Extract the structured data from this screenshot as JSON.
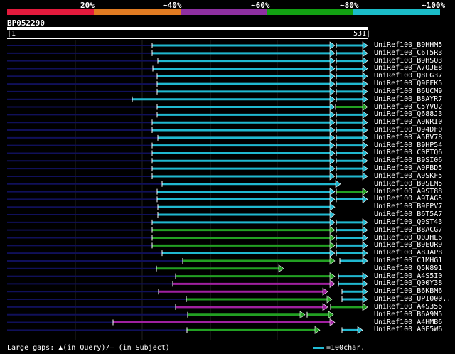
{
  "legend": {
    "colors": [
      "#e31a3c",
      "#e07b22",
      "#8e2fa0",
      "#12a012",
      "#1bbcc8"
    ],
    "ticks": [
      "20%",
      "~40%",
      "~60%",
      "~80%",
      "~100%"
    ]
  },
  "query": {
    "id": "BP052290",
    "start": "1",
    "end": "531"
  },
  "colors": {
    "cyan": "#20b8d0",
    "green": "#22a022",
    "magenta": "#a020a0",
    "navy": "#10105a",
    "white": "#ffffff"
  },
  "hits": [
    {
      "label": "UniRef100_B9HHM5",
      "segs": [
        [
          "n",
          10,
          214
        ],
        [
          "c",
          214,
          470
        ],
        [
          "c",
          473,
          516
        ]
      ]
    },
    {
      "label": "UniRef100_C6T5R3",
      "segs": [
        [
          "n",
          10,
          214
        ],
        [
          "c",
          214,
          470
        ],
        [
          "c",
          473,
          516
        ]
      ]
    },
    {
      "label": "UniRef100_B9HSQ3",
      "segs": [
        [
          "n",
          10,
          222
        ],
        [
          "c",
          222,
          470
        ],
        [
          "c",
          473,
          516
        ]
      ]
    },
    {
      "label": "UniRef100_A7QJE8",
      "segs": [
        [
          "n",
          10,
          215
        ],
        [
          "c",
          215,
          470
        ],
        [
          "c",
          473,
          516
        ]
      ]
    },
    {
      "label": "UniRef100_Q8LG37",
      "segs": [
        [
          "n",
          10,
          221
        ],
        [
          "c",
          221,
          470
        ],
        [
          "c",
          473,
          516
        ]
      ]
    },
    {
      "label": "UniRef100_Q9FFK5",
      "segs": [
        [
          "n",
          10,
          221
        ],
        [
          "c",
          221,
          470
        ],
        [
          "c",
          473,
          516
        ]
      ]
    },
    {
      "label": "UniRef100_B6UCM9",
      "segs": [
        [
          "n",
          10,
          221
        ],
        [
          "c",
          221,
          470
        ],
        [
          "c",
          473,
          516
        ]
      ]
    },
    {
      "label": "UniRef100_B8AYR7",
      "segs": [
        [
          "n",
          10,
          186
        ],
        [
          "c",
          186,
          470
        ],
        [
          "c",
          473,
          516
        ]
      ]
    },
    {
      "label": "UniRef100_C5YVU2",
      "segs": [
        [
          "n",
          10,
          221
        ],
        [
          "c",
          221,
          470
        ],
        [
          "g",
          472,
          516
        ]
      ]
    },
    {
      "label": "UniRef100_Q688J3",
      "segs": [
        [
          "n",
          10,
          221
        ],
        [
          "c",
          221,
          470
        ],
        [
          "c",
          473,
          516
        ]
      ]
    },
    {
      "label": "UniRef100_A9NRI0",
      "segs": [
        [
          "n",
          10,
          214
        ],
        [
          "c",
          214,
          470
        ],
        [
          "c",
          473,
          516
        ]
      ]
    },
    {
      "label": "UniRef100_Q94DF0",
      "segs": [
        [
          "n",
          10,
          214
        ],
        [
          "c",
          214,
          470
        ],
        [
          "c",
          473,
          516
        ]
      ]
    },
    {
      "label": "UniRef100_A5BV78",
      "segs": [
        [
          "n",
          10,
          222
        ],
        [
          "c",
          222,
          470
        ],
        [
          "c",
          473,
          516
        ]
      ]
    },
    {
      "label": "UniRef100_B9HP54",
      "segs": [
        [
          "n",
          10,
          214
        ],
        [
          "c",
          214,
          470
        ],
        [
          "c",
          473,
          516
        ]
      ]
    },
    {
      "label": "UniRef100_C0PTQ6",
      "segs": [
        [
          "n",
          10,
          214
        ],
        [
          "c",
          214,
          470
        ],
        [
          "c",
          473,
          516
        ]
      ]
    },
    {
      "label": "UniRef100_B9SI06",
      "segs": [
        [
          "n",
          10,
          214
        ],
        [
          "c",
          214,
          470
        ],
        [
          "c",
          473,
          516
        ]
      ]
    },
    {
      "label": "UniRef100_A9PBD5",
      "segs": [
        [
          "n",
          10,
          214
        ],
        [
          "c",
          214,
          470
        ],
        [
          "c",
          473,
          516
        ]
      ]
    },
    {
      "label": "UniRef100_A9SKF5",
      "segs": [
        [
          "n",
          10,
          214
        ],
        [
          "c",
          214,
          470
        ],
        [
          "c",
          473,
          516
        ]
      ]
    },
    {
      "label": "UniRef100_B9SLM5",
      "segs": [
        [
          "n",
          10,
          228
        ],
        [
          "c",
          228,
          478
        ]
      ]
    },
    {
      "label": "UniRef100_A9ST88",
      "segs": [
        [
          "n",
          10,
          221
        ],
        [
          "c",
          221,
          470
        ],
        [
          "g",
          473,
          516
        ]
      ]
    },
    {
      "label": "UniRef100_A9TAG5",
      "segs": [
        [
          "n",
          10,
          221
        ],
        [
          "c",
          221,
          470
        ],
        [
          "c",
          473,
          516
        ]
      ]
    },
    {
      "label": "UniRef100_B9FPV7",
      "segs": [
        [
          "n",
          10,
          222
        ],
        [
          "c",
          222,
          470
        ]
      ]
    },
    {
      "label": "UniRef100_B6T5A7",
      "segs": [
        [
          "n",
          10,
          222
        ],
        [
          "c",
          222,
          470
        ]
      ]
    },
    {
      "label": "UniRef100_Q9ST43",
      "segs": [
        [
          "n",
          10,
          214
        ],
        [
          "c",
          214,
          470
        ],
        [
          "c",
          473,
          516
        ]
      ]
    },
    {
      "label": "UniRef100_B8ACG7",
      "segs": [
        [
          "n",
          10,
          214
        ],
        [
          "g",
          214,
          470
        ],
        [
          "c",
          473,
          516
        ]
      ]
    },
    {
      "label": "UniRef100_Q0JHL6",
      "segs": [
        [
          "n",
          10,
          214
        ],
        [
          "g",
          214,
          470
        ],
        [
          "c",
          473,
          516
        ]
      ]
    },
    {
      "label": "UniRef100_B9EUR9",
      "segs": [
        [
          "n",
          10,
          214
        ],
        [
          "g",
          214,
          470
        ],
        [
          "c",
          473,
          516
        ]
      ]
    },
    {
      "label": "UniRef100_A8JAP8",
      "segs": [
        [
          "n",
          10,
          228
        ],
        [
          "c",
          228,
          470
        ],
        [
          "c",
          473,
          516
        ]
      ]
    },
    {
      "label": "UniRef100_C1MHG1",
      "segs": [
        [
          "n",
          10,
          257
        ],
        [
          "g",
          257,
          470
        ],
        [
          "c",
          478,
          516
        ]
      ]
    },
    {
      "label": "UniRef100_Q5N891",
      "segs": [
        [
          "n",
          10,
          220
        ],
        [
          "g",
          220,
          398
        ]
      ]
    },
    {
      "label": "UniRef100_A4S5I0",
      "segs": [
        [
          "n",
          10,
          247
        ],
        [
          "g",
          247,
          470
        ],
        [
          "c",
          476,
          516
        ]
      ]
    },
    {
      "label": "UniRef100_Q00Y38",
      "segs": [
        [
          "n",
          10,
          243
        ],
        [
          "m",
          243,
          470
        ],
        [
          "c",
          476,
          516
        ]
      ]
    },
    {
      "label": "UniRef100_B6KBM6",
      "segs": [
        [
          "n",
          10,
          223
        ],
        [
          "m",
          223,
          460
        ],
        [
          "c",
          481,
          516
        ]
      ]
    },
    {
      "label": "UniRef100_UPI000..",
      "segs": [
        [
          "n",
          10,
          262
        ],
        [
          "g",
          262,
          466
        ],
        [
          "c",
          481,
          516
        ]
      ]
    },
    {
      "label": "UniRef100_A4S356",
      "segs": [
        [
          "n",
          10,
          247
        ],
        [
          "m",
          247,
          460
        ],
        [
          "g",
          465,
          516
        ]
      ]
    },
    {
      "label": "UniRef100_B6A9M5",
      "segs": [
        [
          "n",
          10,
          264
        ],
        [
          "g",
          264,
          428
        ],
        [
          "g",
          432,
          468
        ]
      ]
    },
    {
      "label": "UniRef100_A4HMB6",
      "segs": [
        [
          "n",
          10,
          159
        ],
        [
          "m",
          159,
          470
        ]
      ]
    },
    {
      "label": "UniRef100_A0E5W6",
      "segs": [
        [
          "n",
          10,
          263
        ],
        [
          "g",
          263,
          449
        ],
        [
          "c",
          481,
          509
        ]
      ]
    }
  ],
  "footer": {
    "gaps_text": "Large gaps: ▲(in Query)/— (in Subject)",
    "scale_text": "=100char."
  }
}
